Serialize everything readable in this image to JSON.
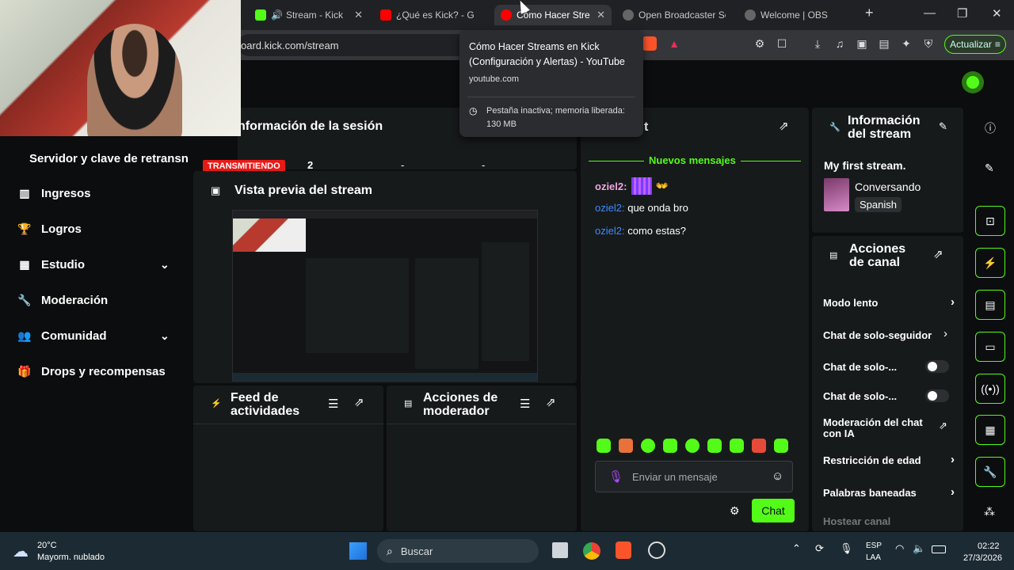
{
  "browser": {
    "tabs": [
      {
        "label": "Stream - Kick",
        "favicon_color": "#53fc18"
      },
      {
        "label": "¿Qué es Kick? - G",
        "favicon_color": "#ff0000"
      },
      {
        "label": "Cómo Hacer Stre",
        "favicon_color": "#ff0000"
      },
      {
        "label": "Open Broadcaster Sof",
        "favicon_color": "#cccccc"
      },
      {
        "label": "Welcome | OBS",
        "favicon_color": "#cccccc"
      }
    ],
    "url": "oard.kick.com/stream",
    "update_label": "Actualizar"
  },
  "tooltip": {
    "title": "Cómo Hacer Streams en Kick (Configuración y Alertas) - YouTube",
    "domain": "youtube.com",
    "memory": "Pestaña inactiva; memoria liberada: 130 MB"
  },
  "sidebar": {
    "stream_key_label": "Servidor y clave de retransn",
    "items": [
      {
        "label": "Ingresos",
        "icon": "bar-chart-icon",
        "expand": false
      },
      {
        "label": "Logros",
        "icon": "trophy-icon",
        "expand": false
      },
      {
        "label": "Estudio",
        "icon": "film-icon",
        "expand": true
      },
      {
        "label": "Moderación",
        "icon": "wrench-icon",
        "expand": false
      },
      {
        "label": "Comunidad",
        "icon": "people-icon",
        "expand": true
      },
      {
        "label": "Drops y recompensas",
        "icon": "gift-icon",
        "expand": false
      }
    ]
  },
  "session": {
    "title": "nformación de la sesión",
    "status": "TRANSMITIENDO",
    "stat1": "2",
    "stat2": "-",
    "stat3": "-"
  },
  "preview": {
    "title": "Vista previa del stream"
  },
  "activity": {
    "title_line1": "Feed de",
    "title_line2": "actividades"
  },
  "modactions": {
    "title_line1": "Acciones de",
    "title_line2": "moderador"
  },
  "chat": {
    "title": "t",
    "new_messages": "Nuevos mensajes",
    "messages": [
      {
        "user": "oziel2",
        "text": ""
      },
      {
        "user": "oziel2",
        "text": "que onda bro"
      },
      {
        "user": "oziel2",
        "text": "como estas?"
      }
    ],
    "placeholder": "Enviar un mensaje",
    "send_label": "Chat"
  },
  "streaminfo": {
    "title_line1": "Información",
    "title_line2": "del stream",
    "stream_title": "My first stream.",
    "category": "Conversando",
    "language": "Spanish"
  },
  "channel_actions": {
    "title_line1": "Acciones",
    "title_line2": "de canal",
    "items": [
      {
        "label": "Modo lento",
        "control": "chevron"
      },
      {
        "label": "Chat de solo-seguidor",
        "control": "chevron"
      },
      {
        "label": "Chat de solo-...",
        "control": "toggle"
      },
      {
        "label": "Chat de solo-...",
        "control": "toggle"
      },
      {
        "label": "Moderación del chat con IA",
        "control": "external"
      },
      {
        "label": "Restricción de edad",
        "control": "chevron"
      },
      {
        "label": "Palabras baneadas",
        "control": "chevron"
      },
      {
        "label": "Hostear canal",
        "control": "none"
      }
    ]
  },
  "taskbar": {
    "weather_temp": "20°C",
    "weather_desc": "Mayorm. nublado",
    "search_placeholder": "Buscar",
    "lang_line1": "ESP",
    "lang_line2": "LAA",
    "time": "02:22",
    "date": "27/3/2026"
  },
  "colors": {
    "accent": "#53fc18",
    "live": "#e91916",
    "panel": "#171a1b",
    "taskbar": "#1c2b33"
  }
}
